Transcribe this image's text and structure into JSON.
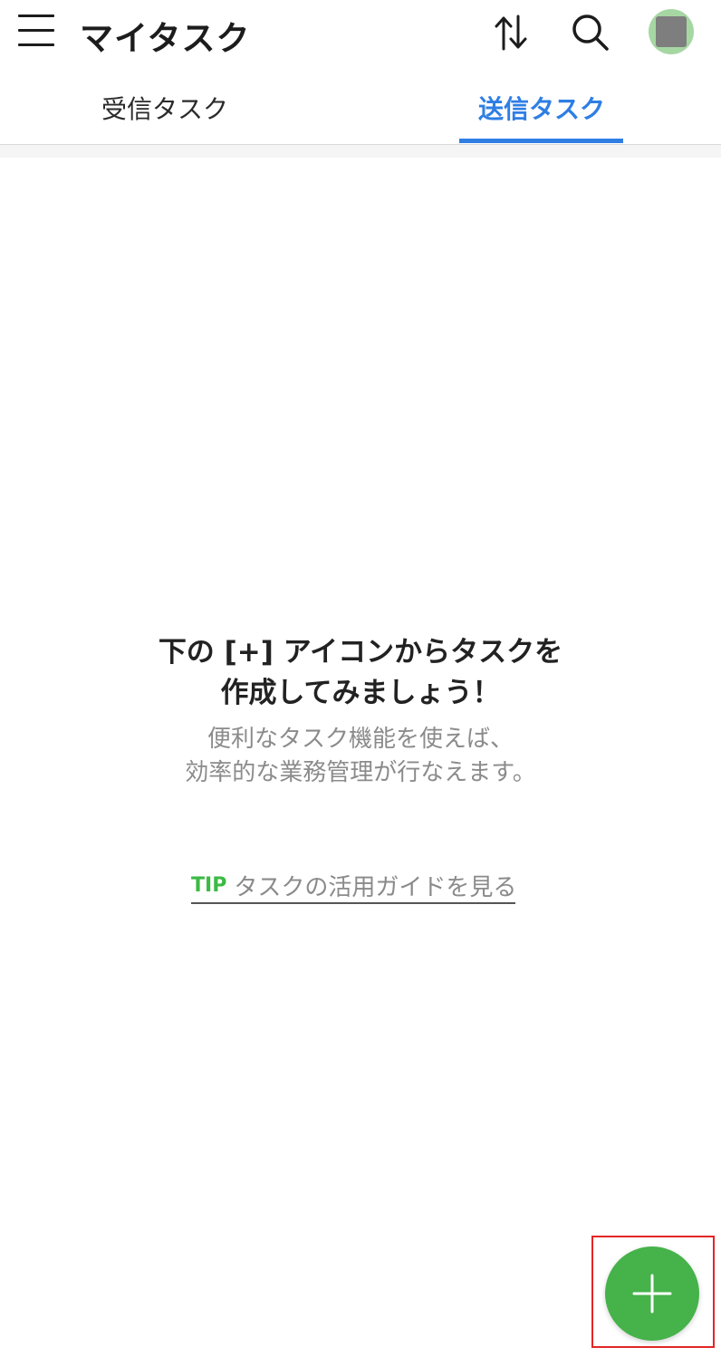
{
  "header": {
    "title": "マイタスク"
  },
  "tabs": [
    {
      "label": "受信タスク",
      "active": false
    },
    {
      "label": "送信タスク",
      "active": true
    }
  ],
  "empty_state": {
    "title_line1": "下の [+] アイコンからタスクを",
    "title_line2": "作成してみましょう！",
    "subtitle_line1": "便利なタスク機能を使えば、",
    "subtitle_line2": "効率的な業務管理が行なえます。",
    "tip_badge": "TIP",
    "tip_text": "タスクの活用ガイドを見る"
  },
  "icons": {
    "menu": "hamburger-menu-icon",
    "sort": "sort-arrows-icon",
    "search": "search-icon",
    "add": "plus-icon"
  },
  "colors": {
    "accent": "#2f7ee4",
    "fab": "#46b24a",
    "tip": "#3bba44",
    "highlight": "#e32626"
  }
}
